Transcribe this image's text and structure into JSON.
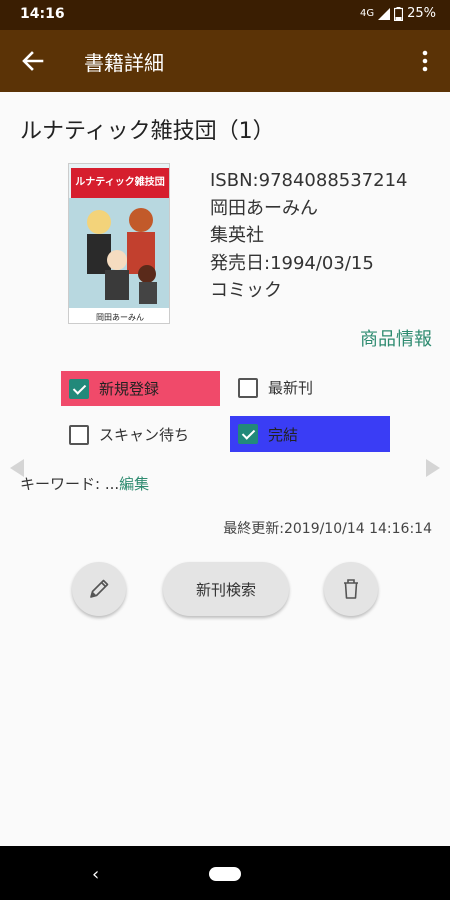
{
  "status_bar": {
    "time": "14:16",
    "network": "4G",
    "battery": "25%"
  },
  "app_bar": {
    "title": "書籍詳細"
  },
  "book": {
    "title": "ルナティック雑技団（1）",
    "cover_title": "ルナティック雑技団",
    "cover_author": "岡田あーみん",
    "isbn": "ISBN:9784088537214",
    "author": "岡田あーみん",
    "publisher": "集英社",
    "release_date": "発売日:1994/03/15",
    "category": "コミック"
  },
  "product_info_link": "商品情報",
  "flags": {
    "new_registration": {
      "label": "新規登録",
      "checked": true,
      "color": "#f04a6a"
    },
    "latest": {
      "label": "最新刊",
      "checked": false
    },
    "scan_waiting": {
      "label": "スキャン待ち",
      "checked": false
    },
    "completed": {
      "label": "完結",
      "checked": true,
      "color": "#3a3df5"
    }
  },
  "keyword": {
    "label": "キーワード: ...",
    "edit_label": "編集"
  },
  "last_updated": "最終更新:2019/10/14 14:16:14",
  "actions": {
    "search_new_label": "新刊検索",
    "edit_icon": "pencil-icon",
    "delete_icon": "trash-icon"
  },
  "colors": {
    "status_bar": "#3a1e02",
    "app_bar": "#5b3306",
    "accent": "#2e8b70",
    "checkbox": "#22897a"
  }
}
